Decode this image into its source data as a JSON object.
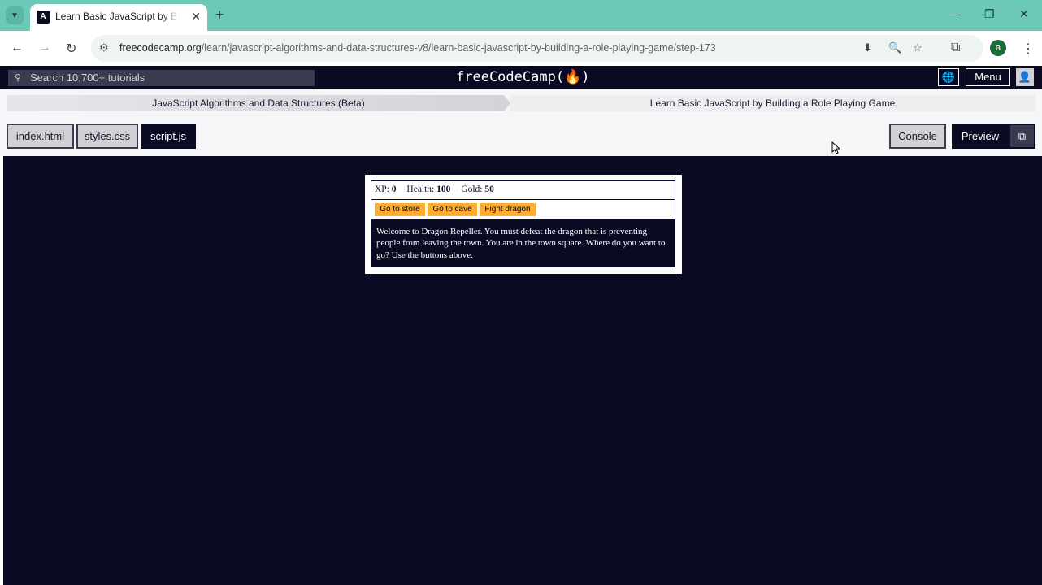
{
  "browser": {
    "tab_title": "Learn Basic JavaScript by Building a Role Playing Game",
    "url_host": "freecodecamp.org",
    "url_path": "/learn/javascript-algorithms-and-data-structures-v8/learn-basic-javascript-by-building-a-role-playing-game/step-173",
    "profile_initial": "a"
  },
  "header": {
    "search_placeholder": "Search 10,700+ tutorials",
    "brand": "freeCodeCamp(🔥)",
    "menu_label": "Menu"
  },
  "breadcrumb": {
    "superblock": "JavaScript Algorithms and Data Structures (Beta)",
    "block": "Learn Basic JavaScript by Building a Role Playing Game"
  },
  "editor": {
    "tabs": [
      "index.html",
      "styles.css",
      "script.js"
    ],
    "active_tab": "script.js",
    "console_label": "Console",
    "preview_label": "Preview"
  },
  "game": {
    "stats": [
      {
        "label": "XP:",
        "value": "0"
      },
      {
        "label": "Health:",
        "value": "100"
      },
      {
        "label": "Gold:",
        "value": "50"
      }
    ],
    "buttons": [
      "Go to store",
      "Go to cave",
      "Fight dragon"
    ],
    "text": "Welcome to Dragon Repeller. You must defeat the dragon that is preventing people from leaving the town. You are in the town square. Where do you want to go? Use the buttons above."
  },
  "colors": {
    "tabbar": "#6cc9b8",
    "fcc_dark": "#0a0a23",
    "button_gold": "#feac32"
  }
}
